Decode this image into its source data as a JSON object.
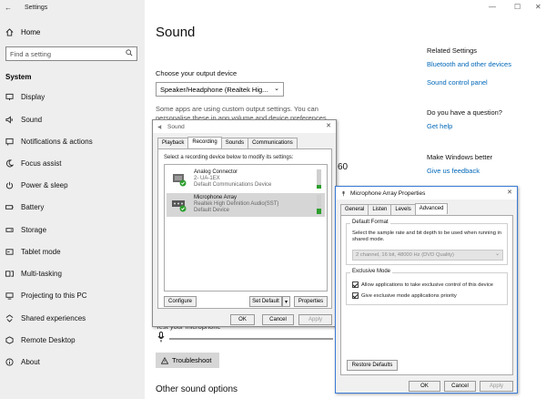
{
  "window": {
    "title": "Settings"
  },
  "sidebar": {
    "home": "Home",
    "search_placeholder": "Find a setting",
    "section": "System",
    "items": [
      {
        "label": "Display",
        "icon": "display-icon"
      },
      {
        "label": "Sound",
        "icon": "speaker-icon"
      },
      {
        "label": "Notifications & actions",
        "icon": "notification-icon"
      },
      {
        "label": "Focus assist",
        "icon": "moon-icon"
      },
      {
        "label": "Power & sleep",
        "icon": "power-icon"
      },
      {
        "label": "Battery",
        "icon": "battery-icon"
      },
      {
        "label": "Storage",
        "icon": "storage-icon"
      },
      {
        "label": "Tablet mode",
        "icon": "tablet-icon"
      },
      {
        "label": "Multi-tasking",
        "icon": "multitask-icon"
      },
      {
        "label": "Projecting to this PC",
        "icon": "projector-icon"
      },
      {
        "label": "Shared experiences",
        "icon": "shared-icon"
      },
      {
        "label": "Remote Desktop",
        "icon": "remote-icon"
      },
      {
        "label": "About",
        "icon": "info-icon"
      }
    ]
  },
  "main": {
    "title": "Sound",
    "output_label": "Choose your output device",
    "output_value": "Speaker/Headphone (Realtek Hig...",
    "note": "Some apps are using custom output settings. You can personalise these in app volume and device preferences below.",
    "partial_number": "60",
    "test_mic_label": "Test your microphone",
    "troubleshoot": "Troubleshoot",
    "other_options": "Other sound options"
  },
  "related": {
    "heading": "Related Settings",
    "links": [
      "Bluetooth and other devices",
      "Sound control panel"
    ],
    "question": "Do you have a question?",
    "help": "Get help",
    "better": "Make Windows better",
    "feedback": "Give us feedback"
  },
  "sound_dialog": {
    "title": "Sound",
    "tabs": [
      "Playback",
      "Recording",
      "Sounds",
      "Communications"
    ],
    "instruction": "Select a recording device below to modify its settings:",
    "devices": [
      {
        "name": "Analog Connector",
        "line1": "2- UA-1EX",
        "line2": "Default Communications Device",
        "level": 0.2
      },
      {
        "name": "Microphone Array",
        "line1": "Realtek High Definition Audio(SST)",
        "line2": "Default Device",
        "level": 0.3
      }
    ],
    "configure": "Configure",
    "set_default": "Set Default",
    "properties": "Properties",
    "ok": "OK",
    "cancel": "Cancel",
    "apply": "Apply"
  },
  "props_dialog": {
    "title": "Microphone Array Properties",
    "tabs": [
      "General",
      "Listen",
      "Levels",
      "Advanced"
    ],
    "default_format": {
      "label": "Default Format",
      "desc": "Select the sample rate and bit depth to be used when running in shared mode.",
      "value": "2 channel, 16 bit, 48000 Hz (DVD Quality)"
    },
    "exclusive": {
      "label": "Exclusive Mode",
      "opt1": "Allow applications to take exclusive control of this device",
      "opt2": "Give exclusive mode applications priority"
    },
    "restore": "Restore Defaults",
    "ok": "OK",
    "cancel": "Cancel",
    "apply": "Apply"
  }
}
